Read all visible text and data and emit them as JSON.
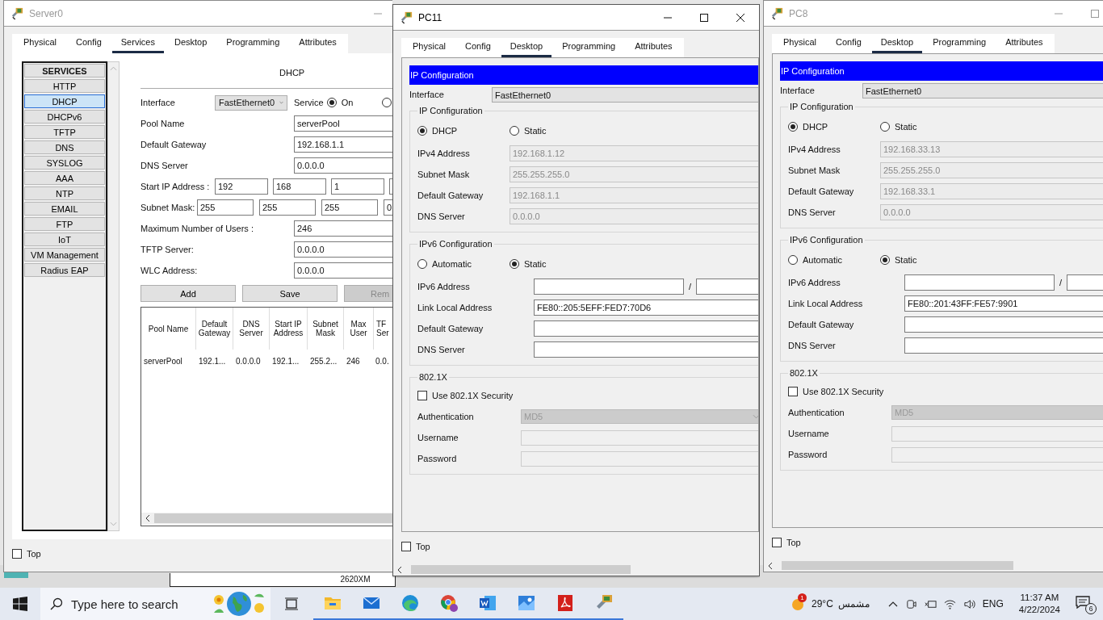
{
  "windows": [
    {
      "kind": "server",
      "title": "Server0",
      "active": false,
      "tabs": [
        {
          "label": "Physical",
          "selected": false
        },
        {
          "label": "Config",
          "selected": false
        },
        {
          "label": "Services",
          "selected": true
        },
        {
          "label": "Desktop",
          "selected": false
        },
        {
          "label": "Programming",
          "selected": false
        },
        {
          "label": "Attributes",
          "selected": false
        }
      ],
      "services": {
        "header": "SERVICES",
        "items": [
          {
            "label": "HTTP",
            "selected": false
          },
          {
            "label": "DHCP",
            "selected": true
          },
          {
            "label": "DHCPv6",
            "selected": false
          },
          {
            "label": "TFTP",
            "selected": false
          },
          {
            "label": "DNS",
            "selected": false
          },
          {
            "label": "SYSLOG",
            "selected": false
          },
          {
            "label": "AAA",
            "selected": false
          },
          {
            "label": "NTP",
            "selected": false
          },
          {
            "label": "EMAIL",
            "selected": false
          },
          {
            "label": "FTP",
            "selected": false
          },
          {
            "label": "IoT",
            "selected": false
          },
          {
            "label": "VM Management",
            "selected": false
          },
          {
            "label": "Radius EAP",
            "selected": false
          }
        ]
      },
      "dhcp": {
        "title": "DHCP",
        "interface": {
          "label": "Interface",
          "value": "FastEthernet0"
        },
        "service": {
          "label": "Service",
          "on": {
            "label": "On",
            "selected": true
          },
          "off": {
            "selected": false
          }
        },
        "fields": [
          {
            "label": "Pool Name",
            "value": "serverPool"
          },
          {
            "label": "Default Gateway",
            "value": "192.168.1.1"
          },
          {
            "label": "DNS Server",
            "value": "0.0.0.0"
          }
        ],
        "start_ip": {
          "label": "Start IP Address :",
          "octets": [
            "192",
            "168",
            "1"
          ]
        },
        "subnet": {
          "label": "Subnet Mask:",
          "octets": [
            "255",
            "255",
            "255",
            "0"
          ]
        },
        "fields2": [
          {
            "label": "Maximum Number of Users :",
            "value": "246"
          },
          {
            "label": "TFTP Server:",
            "value": "0.0.0.0"
          },
          {
            "label": "WLC Address:",
            "value": "0.0.0.0"
          }
        ],
        "buttons": [
          {
            "label": "Add",
            "disabled": false
          },
          {
            "label": "Save",
            "disabled": false
          },
          {
            "label": "Rem",
            "disabled": true
          }
        ],
        "table": {
          "columns": [
            "Pool Name",
            "Default Gateway",
            "DNS Server",
            "Start IP Address",
            "Subnet Mask",
            "Max User",
            "TF Ser"
          ],
          "rows": [
            [
              "serverPool",
              "192.1...",
              "0.0.0.0",
              "192.1...",
              "255.2...",
              "246",
              "0.0."
            ]
          ]
        }
      },
      "top": {
        "label": "Top",
        "checked": false
      }
    },
    {
      "kind": "pc",
      "title": "PC11",
      "active": true,
      "tabs": [
        {
          "label": "Physical",
          "selected": false
        },
        {
          "label": "Config",
          "selected": false
        },
        {
          "label": "Desktop",
          "selected": true
        },
        {
          "label": "Programming",
          "selected": false
        },
        {
          "label": "Attributes",
          "selected": false
        }
      ],
      "ipconfig": {
        "title": "IP Configuration",
        "interface": {
          "label": "Interface",
          "value": "FastEthernet0"
        },
        "ipv4": {
          "legend": "IP Configuration",
          "modes": [
            {
              "label": "DHCP",
              "selected": true
            },
            {
              "label": "Static",
              "selected": false
            }
          ],
          "fields": [
            {
              "label": "IPv4 Address",
              "value": "192.168.1.12",
              "disabled": true
            },
            {
              "label": "Subnet Mask",
              "value": "255.255.255.0",
              "disabled": true
            },
            {
              "label": "Default Gateway",
              "value": "192.168.1.1",
              "disabled": true
            },
            {
              "label": "DNS Server",
              "value": "0.0.0.0",
              "disabled": true
            }
          ]
        },
        "ipv6": {
          "legend": "IPv6 Configuration",
          "modes": [
            {
              "label": "Automatic",
              "selected": false
            },
            {
              "label": "Static",
              "selected": true
            }
          ],
          "address": {
            "label": "IPv6 Address",
            "separator": "/"
          },
          "fields": [
            {
              "label": "Link Local Address",
              "value": "FE80::205:5EFF:FED7:70D6",
              "disabled": false
            },
            {
              "label": "Default Gateway",
              "disabled": false
            },
            {
              "label": "DNS Server",
              "disabled": false
            }
          ]
        },
        "dot1x": {
          "legend": "802.1X",
          "use": {
            "label": "Use 802.1X Security",
            "checked": false
          },
          "authentication": {
            "label": "Authentication",
            "value": "MD5"
          },
          "fields": [
            {
              "label": "Username"
            },
            {
              "label": "Password"
            }
          ]
        }
      },
      "top": {
        "label": "Top",
        "checked": false
      }
    },
    {
      "kind": "pc",
      "title": "PC8",
      "active": false,
      "tabs": [
        {
          "label": "Physical",
          "selected": false
        },
        {
          "label": "Config",
          "selected": false
        },
        {
          "label": "Desktop",
          "selected": true
        },
        {
          "label": "Programming",
          "selected": false
        },
        {
          "label": "Attributes",
          "selected": false
        }
      ],
      "ipconfig": {
        "title": "IP Configuration",
        "interface": {
          "label": "Interface",
          "value": "FastEthernet0"
        },
        "ipv4": {
          "legend": "IP Configuration",
          "modes": [
            {
              "label": "DHCP",
              "selected": true
            },
            {
              "label": "Static",
              "selected": false
            }
          ],
          "fields": [
            {
              "label": "IPv4 Address",
              "value": "192.168.33.13",
              "disabled": true
            },
            {
              "label": "Subnet Mask",
              "value": "255.255.255.0",
              "disabled": true
            },
            {
              "label": "Default Gateway",
              "value": "192.168.33.1",
              "disabled": true
            },
            {
              "label": "DNS Server",
              "value": "0.0.0.0",
              "disabled": true
            }
          ]
        },
        "ipv6": {
          "legend": "IPv6 Configuration",
          "modes": [
            {
              "label": "Automatic",
              "selected": false
            },
            {
              "label": "Static",
              "selected": true
            }
          ],
          "address": {
            "label": "IPv6 Address",
            "separator": "/"
          },
          "fields": [
            {
              "label": "Link Local Address",
              "value": "FE80::201:43FF:FE57:9901",
              "disabled": false
            },
            {
              "label": "Default Gateway",
              "disabled": false
            },
            {
              "label": "DNS Server",
              "disabled": false
            }
          ]
        },
        "dot1x": {
          "legend": "802.1X",
          "use": {
            "label": "Use 802.1X Security",
            "checked": false
          },
          "authentication": {
            "label": "Authentication",
            "value": "MD5"
          },
          "fields": [
            {
              "label": "Username"
            },
            {
              "label": "Password"
            }
          ]
        }
      },
      "top": {
        "label": "Top",
        "checked": false
      }
    }
  ],
  "desktop": {
    "device_label": "2620XM"
  },
  "taskbar": {
    "search": {
      "placeholder": "Type here to search"
    },
    "apps": [
      {
        "kind": "folder",
        "running": true
      },
      {
        "kind": "mail",
        "running": true
      },
      {
        "kind": "edge",
        "running": true
      },
      {
        "kind": "chrome",
        "running": true
      },
      {
        "kind": "word",
        "running": true
      },
      {
        "kind": "maps",
        "running": true
      },
      {
        "kind": "pdf",
        "running": true
      },
      {
        "kind": "tracer",
        "running": true
      }
    ],
    "weather": {
      "badge": "1",
      "temperature": "29°C",
      "condition": "مشمس"
    },
    "language": "ENG",
    "time": "11:37 AM",
    "date": "4/22/2024",
    "notifications": "6"
  }
}
